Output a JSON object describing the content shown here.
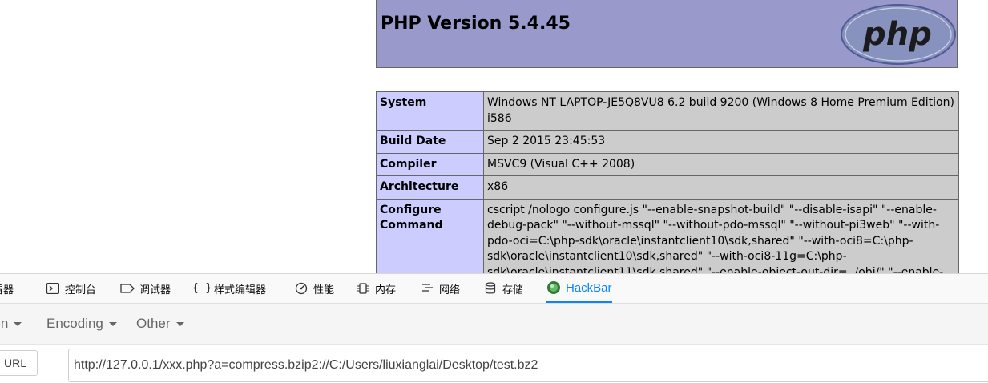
{
  "php": {
    "title": "PHP Version 5.4.45",
    "logo_text": "php",
    "rows": [
      {
        "key": "System",
        "value": "Windows NT LAPTOP-JE5Q8VU8 6.2 build 9200 (Windows 8 Home Premium Edition) i586"
      },
      {
        "key": "Build Date",
        "value": "Sep 2 2015 23:45:53"
      },
      {
        "key": "Compiler",
        "value": "MSVC9 (Visual C++ 2008)"
      },
      {
        "key": "Architecture",
        "value": "x86"
      },
      {
        "key": "Configure Command",
        "value": "cscript /nologo configure.js \"--enable-snapshot-build\" \"--disable-isapi\" \"--enable-debug-pack\" \"--without-mssql\" \"--without-pdo-mssql\" \"--without-pi3web\" \"--with-pdo-oci=C:\\php-sdk\\oracle\\instantclient10\\sdk,shared\" \"--with-oci8=C:\\php-sdk\\oracle\\instantclient10\\sdk,shared\" \"--with-oci8-11g=C:\\php-sdk\\oracle\\instantclient11\\sdk,shared\" \"--enable-object-out-dir=../obj/\" \"--enable-com-"
      }
    ]
  },
  "devtools": {
    "tabs": [
      {
        "label": "查看器",
        "icon": "inspector-icon"
      },
      {
        "label": "控制台",
        "icon": "console-icon"
      },
      {
        "label": "调试器",
        "icon": "debugger-icon"
      },
      {
        "label": "样式编辑器",
        "icon": "style-editor-icon"
      },
      {
        "label": "性能",
        "icon": "performance-icon"
      },
      {
        "label": "内存",
        "icon": "memory-icon"
      },
      {
        "label": "网络",
        "icon": "network-icon"
      },
      {
        "label": "存储",
        "icon": "storage-icon"
      },
      {
        "label": "HackBar",
        "icon": "hackbar-icon"
      }
    ],
    "active_tab": "HackBar",
    "accent": "#0a84ff"
  },
  "hackbar": {
    "menus": [
      {
        "label": "Encryption"
      },
      {
        "label": "Encoding"
      },
      {
        "label": "Other"
      }
    ],
    "url_button": "URL",
    "url_value": "http://127.0.0.1/xxx.php?a=compress.bzip2://C:/Users/liuxianglai/Desktop/test.bz2"
  }
}
